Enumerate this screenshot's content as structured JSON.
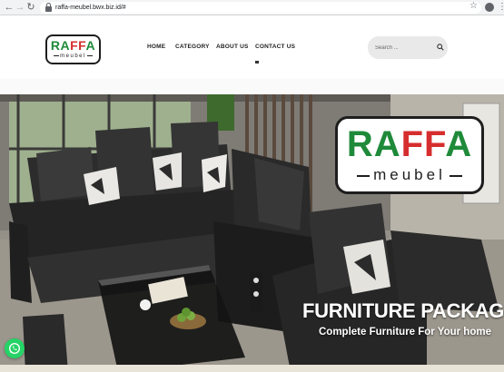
{
  "browser": {
    "url": "raffa-meubel.bwx.biz.id/#",
    "back_icon": "arrow-left-icon",
    "forward_icon": "arrow-right-icon",
    "reload_icon": "reload-icon"
  },
  "header": {
    "logo": {
      "part1": "RA",
      "part2": "FF",
      "part3": "A",
      "tagline": "meubel"
    },
    "menu": [
      {
        "label": "HOME"
      },
      {
        "label": "CATEGORY"
      },
      {
        "label": "ABOUT US"
      },
      {
        "label": "CONTACT US"
      }
    ],
    "search": {
      "placeholder": "Search ..."
    }
  },
  "hero": {
    "logo": {
      "part1": "RA",
      "part2": "FF",
      "part3": "A",
      "tagline": "meubel"
    },
    "title": "FURNITURE PACKAGE",
    "subtitle": "Complete Furniture For Your home"
  },
  "colors": {
    "brand_green": "#1f8a3a",
    "brand_red": "#d62e2e",
    "whatsapp": "#25d366"
  }
}
